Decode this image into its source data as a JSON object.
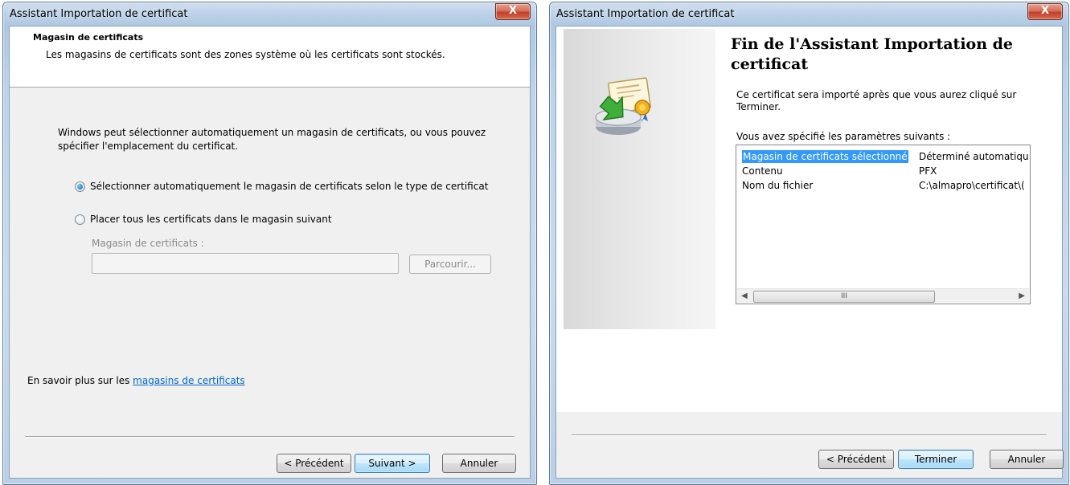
{
  "left_dialog": {
    "title": "Assistant Importation de certificat",
    "close_label": "X",
    "header_title": "Magasin de certificats",
    "header_description": "Les magasins de certificats sont des zones système où les certificats sont stockés.",
    "explanation": "Windows peut sélectionner automatiquement un magasin de certificats, ou vous pouvez spécifier l'emplacement du certificat.",
    "options": [
      {
        "label": "Sélectionner automatiquement le magasin de certificats selon le type de certificat",
        "selected": true
      },
      {
        "label": "Placer tous les certificats dans le magasin suivant",
        "selected": false
      }
    ],
    "store_label": "Magasin de certificats :",
    "store_value": "",
    "browse_label": "Parcourir...",
    "learn_prefix": "En savoir plus sur les ",
    "learn_link": "magasins de certificats",
    "buttons": {
      "back": "< Précédent",
      "next": "Suivant >",
      "cancel": "Annuler"
    }
  },
  "right_dialog": {
    "title": "Assistant Importation de certificat",
    "close_label": "X",
    "heading": "Fin de l'Assistant Importation de certificat",
    "description": "Ce certificat sera importé après que vous aurez cliqué sur Terminer.",
    "settings_label": "Vous avez spécifié les paramètres suivants :",
    "settings": [
      {
        "name": "Magasin de certificats sélectionné",
        "value": "Déterminé automatiqu"
      },
      {
        "name": "Contenu",
        "value": "PFX"
      },
      {
        "name": "Nom du fichier",
        "value": "C:\\almapro\\certificat\\("
      }
    ],
    "scroll_thumb": "III",
    "icon": "certificate-import-icon",
    "buttons": {
      "back": "< Précédent",
      "finish": "Terminer",
      "cancel": "Annuler"
    }
  }
}
